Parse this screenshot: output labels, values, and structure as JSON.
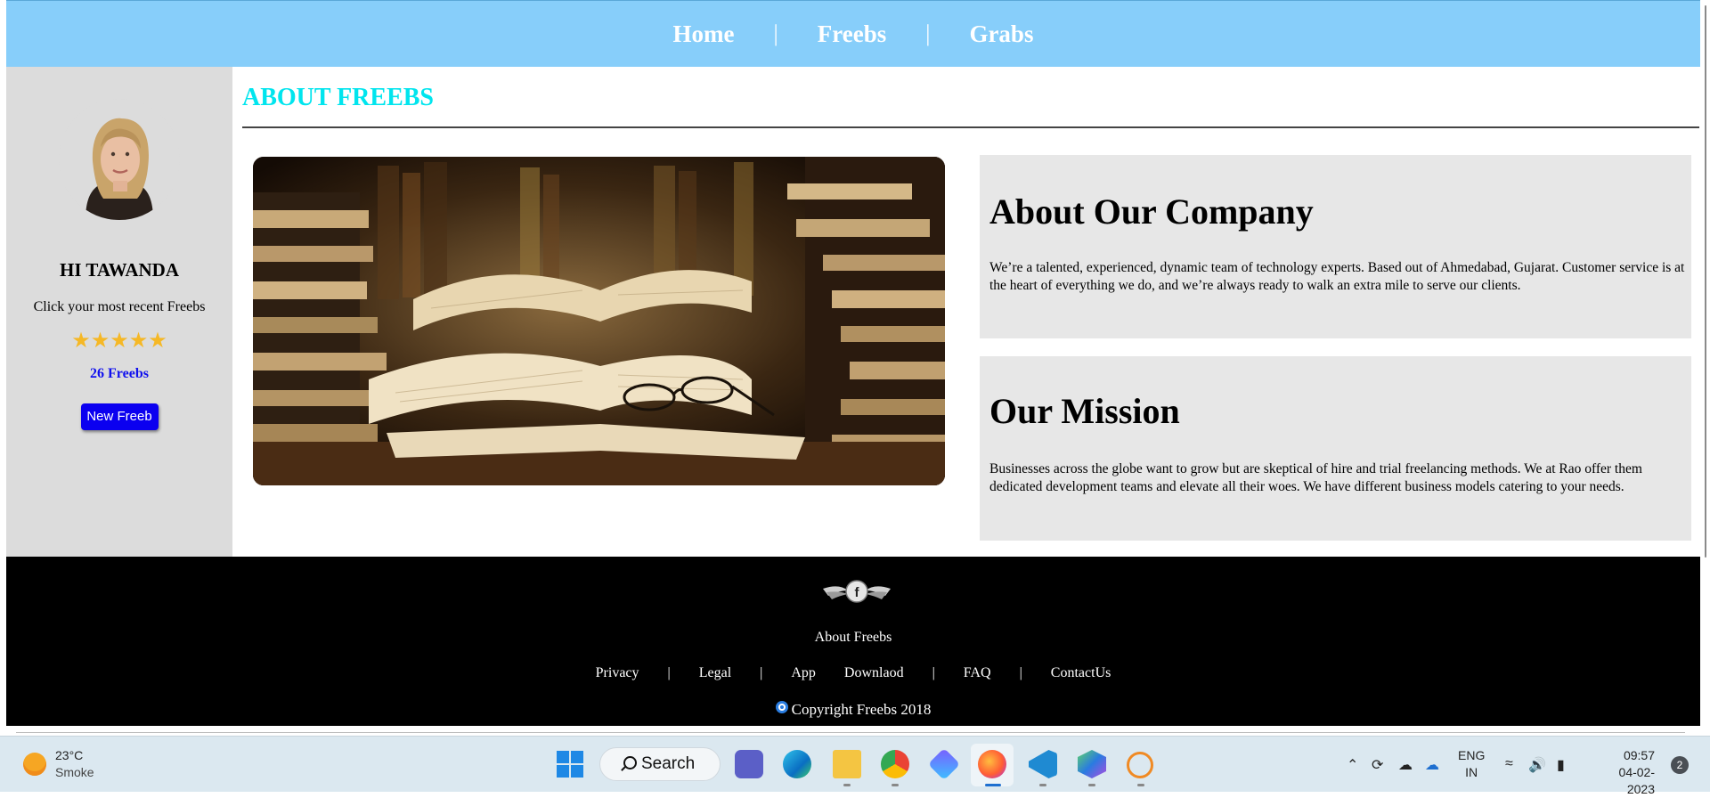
{
  "nav": {
    "items": [
      "Home",
      "Freebs",
      "Grabs"
    ],
    "separator": "|"
  },
  "sidebar": {
    "greeting": "HI TAWANDA",
    "recent_text": "Click your most recent Freebs",
    "stars": "★★★★★",
    "rating": 5,
    "count": "26 Freebs",
    "new_button": "New Freeb"
  },
  "main": {
    "title": "ABOUT FREEBS",
    "cards": [
      {
        "heading": "About Our Company",
        "body": "We’re a talented, experienced, dynamic team of technology experts. Based out of Ahmedabad, Gujarat. Customer service is at the heart of everything we do, and we’re always ready to walk an extra mile to serve our clients."
      },
      {
        "heading": "Our Mission",
        "body": "Businesses across the globe want to grow but are skeptical of hire and trial freelancing methods. We at Rao offer them dedicated development teams and elevate all their woes. We have different business models catering to your needs."
      }
    ]
  },
  "footer": {
    "about": "About Freebs",
    "links": [
      "Privacy",
      "Legal",
      "App",
      "Downlaod",
      "FAQ",
      "ContactUs"
    ],
    "copyright": "Copyright Freebs 2018"
  },
  "taskbar": {
    "weather": {
      "temp": "23°C",
      "condition": "Smoke"
    },
    "search_label": "Search",
    "lang": [
      "ENG",
      "IN"
    ],
    "time": "09:57",
    "date": "04-02-2023",
    "notifications": "2"
  },
  "colors": {
    "nav_bg": "#87cefa",
    "title_cyan": "#00e5ee",
    "star": "#f5b826",
    "button_blue": "#0b00f0",
    "count_blue": "#1010ee"
  }
}
